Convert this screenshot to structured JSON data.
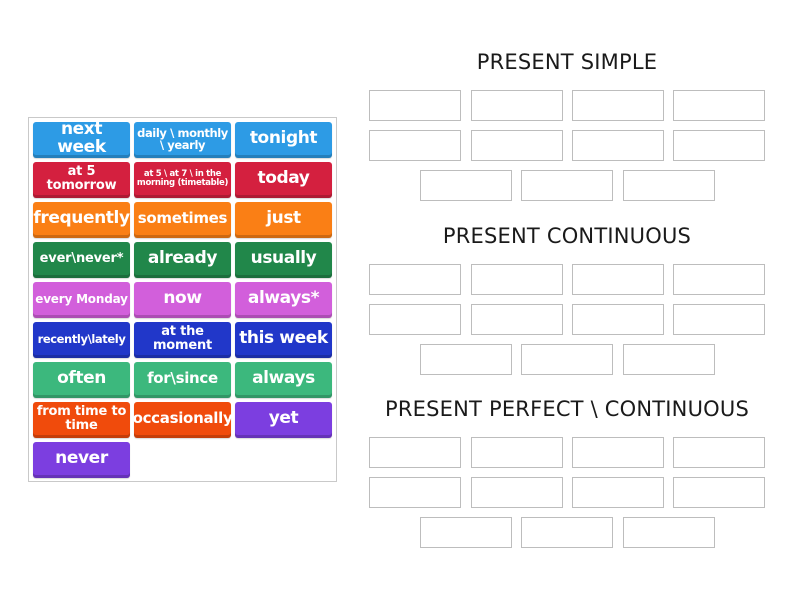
{
  "palette": {
    "blue": "#2d9be5",
    "crimson": "#d4203f",
    "orange": "#fa7f15",
    "dark_green": "#21874a",
    "magenta": "#d25fdb",
    "royal_blue": "#2137c9",
    "mint_green": "#3cb87d",
    "red_orange": "#f04b0c",
    "purple": "#7c3ee0",
    "slot_border": "#bdbdbd",
    "heading_text": "#1a1a1a"
  },
  "tiles": [
    {
      "label": "next week",
      "color": "#2d9be5"
    },
    {
      "label": "daily \\ monthly \\ yearly",
      "color": "#2d9be5"
    },
    {
      "label": "tonight",
      "color": "#2d9be5"
    },
    {
      "label": "at 5 tomorrow",
      "color": "#d4203f"
    },
    {
      "label": "at 5 \\ at 7 \\ in the morning (timetable)",
      "color": "#d4203f"
    },
    {
      "label": "today",
      "color": "#d4203f"
    },
    {
      "label": "frequently",
      "color": "#fa7f15"
    },
    {
      "label": "sometimes",
      "color": "#fa7f15"
    },
    {
      "label": "just",
      "color": "#fa7f15"
    },
    {
      "label": "ever\\never*",
      "color": "#21874a"
    },
    {
      "label": "already",
      "color": "#21874a"
    },
    {
      "label": "usually",
      "color": "#21874a"
    },
    {
      "label": "every Monday",
      "color": "#d25fdb"
    },
    {
      "label": "now",
      "color": "#d25fdb"
    },
    {
      "label": "always*",
      "color": "#d25fdb"
    },
    {
      "label": "recently\\lately",
      "color": "#2137c9"
    },
    {
      "label": "at the moment",
      "color": "#2137c9"
    },
    {
      "label": "this week",
      "color": "#2137c9"
    },
    {
      "label": "often",
      "color": "#3cb87d"
    },
    {
      "label": "for\\since",
      "color": "#3cb87d"
    },
    {
      "label": "always",
      "color": "#3cb87d"
    },
    {
      "label": "from time to time",
      "color": "#f04b0c"
    },
    {
      "label": "occasionally",
      "color": "#f04b0c"
    },
    {
      "label": "yet",
      "color": "#7c3ee0"
    },
    {
      "label": "never",
      "color": "#7c3ee0"
    }
  ],
  "groups": [
    {
      "title": "PRESENT SIMPLE",
      "slot_count": 11
    },
    {
      "title": "PRESENT CONTINUOUS",
      "slot_count": 11
    },
    {
      "title": "PRESENT PERFECT \\ CONTINUOUS",
      "slot_count": 11
    }
  ]
}
